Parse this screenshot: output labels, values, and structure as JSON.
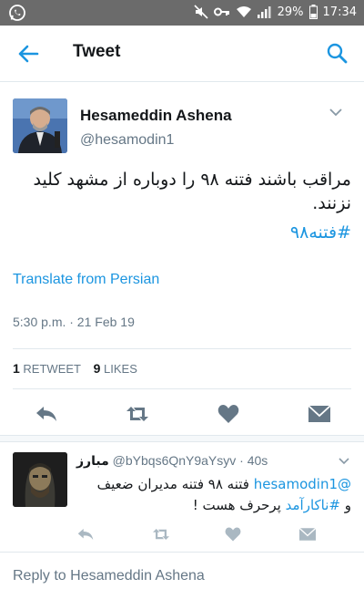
{
  "status_bar": {
    "battery": "29%",
    "time": "17:34"
  },
  "header": {
    "title": "Tweet",
    "back_icon": "arrow-left-icon",
    "search_icon": "search-icon"
  },
  "tweet": {
    "author_name": "Hesameddin Ashena",
    "author_handle": "@hesamodin1",
    "text": "مراقب باشند فتنه ۹۸ را دوباره از مشهد کلید نزنند.",
    "hashtag": "#فتنه۹۸",
    "translate_label": "Translate from Persian",
    "timestamp": "5:30 p.m. · 21 Feb 19",
    "retweets_count": "1",
    "retweets_label": "RETWEET",
    "likes_count": "9",
    "likes_label": "LIKES"
  },
  "reply": {
    "author_name": "مبارز",
    "author_handle": "@bYbqs6QnY9aYsyv",
    "time": "· 40s",
    "mention": "@hesamodin1",
    "text_line1": "فتنه ۹۸ فتنه مدیران ضعیف",
    "text_line2_prefix": "و ",
    "hashtag": "#ناکارآمد",
    "text_line2_suffix": " پرحرف هست !"
  },
  "compose": {
    "placeholder": "Reply to Hesameddin Ashena"
  },
  "colors": {
    "accent": "#1b95e0",
    "status_bar": "#6b6b6b",
    "muted": "#657786"
  }
}
